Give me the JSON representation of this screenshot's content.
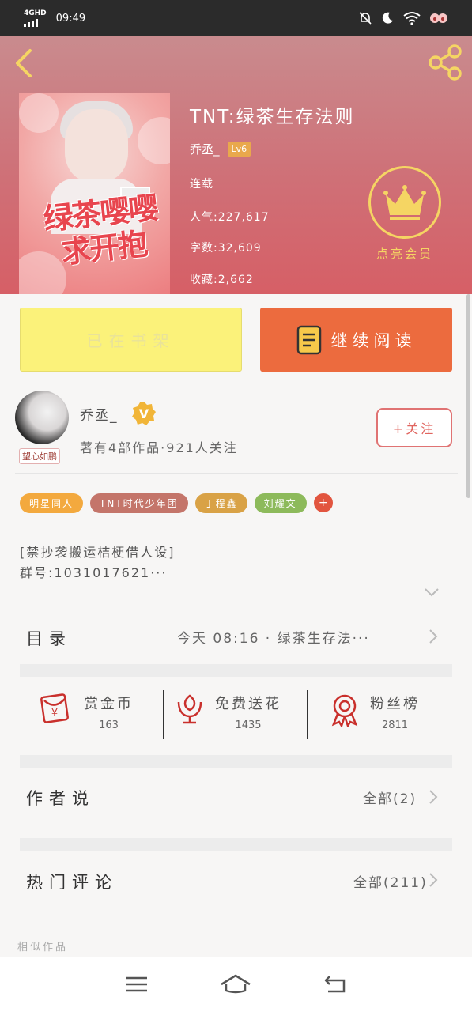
{
  "status_bar": {
    "network": "4GHD",
    "time": "09:49",
    "icons": [
      "mute-bell-icon",
      "moon-icon",
      "wifi-icon",
      "app-notification-icon"
    ]
  },
  "header": {
    "back_icon": "back-arrow-icon",
    "share_icon": "share-icon",
    "book_title": "TNT:绿茶生存法则",
    "author": "乔丞_",
    "author_level": "Lv6",
    "status": "连载",
    "popularity": "人气:227,617",
    "word_count": "字数:32,609",
    "favorites": "收藏:2,662",
    "vip_label": "点亮会员",
    "cover_art_text": "绿茶嘤嘤\n求开抱",
    "colors": {
      "gradient_top": "#c98b8e",
      "gradient_bottom": "#d65f66",
      "vip_gold": "#f5d563"
    }
  },
  "actions": {
    "shelf_label": "已在书架",
    "read_label": "继续阅读",
    "colors": {
      "shelf": "#fbf27a",
      "read": "#ec6b3e"
    }
  },
  "author_card": {
    "avatar_tag": "望心如鹏",
    "name": "乔丞_",
    "badge": "V",
    "info": "著有4部作品·921人关注",
    "follow_label": "+关注"
  },
  "tags": [
    {
      "label": "明星同人",
      "color": "#f3a93e"
    },
    {
      "label": "TNT时代少年团",
      "color": "#c4756a"
    },
    {
      "label": "丁程鑫",
      "color": "#d9a246"
    },
    {
      "label": "刘耀文",
      "color": "#8dba5b"
    }
  ],
  "tag_add": "+",
  "description": {
    "line1": "[禁抄袭搬运桔梗借人设]",
    "line2": "群号:1031017621···"
  },
  "toc": {
    "label": "目录",
    "latest": "今天 08:16 · 绿茶生存法···"
  },
  "stats": [
    {
      "label": "赏金币",
      "value": "163",
      "icon": "red-envelope-icon"
    },
    {
      "label": "免费送花",
      "value": "1435",
      "icon": "flower-icon"
    },
    {
      "label": "粉丝榜",
      "value": "2811",
      "icon": "medal-icon"
    }
  ],
  "author_notes": {
    "label": "作者说",
    "all": "全部(2)"
  },
  "hot_comments": {
    "label": "热门评论",
    "all": "全部(211)"
  },
  "similar_label": "相似作品",
  "navbar": {
    "icons": [
      "menu-icon",
      "home-icon",
      "back-icon"
    ]
  }
}
